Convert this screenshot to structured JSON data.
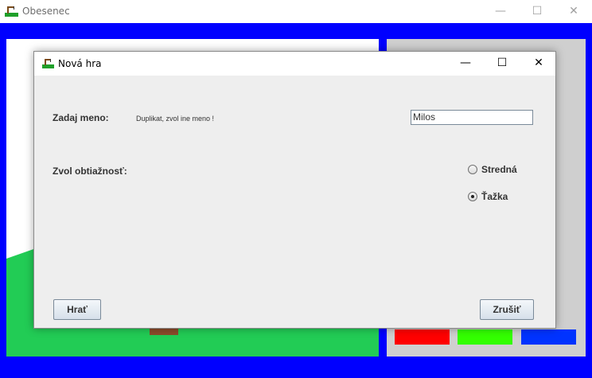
{
  "main_window": {
    "title": "Obesenec",
    "controls": {
      "minimize": "—",
      "maximize": "☐",
      "close": "✕"
    },
    "icon": "gallows-icon"
  },
  "color_swatches": [
    {
      "name": "red",
      "color": "#ff0000"
    },
    {
      "name": "green",
      "color": "#33ff00"
    },
    {
      "name": "blue",
      "color": "#0033ff"
    }
  ],
  "dialog": {
    "title": "Nová hra",
    "icon": "gallows-icon",
    "controls": {
      "minimize": "—",
      "maximize": "☐",
      "close": "✕"
    },
    "name_label": "Zadaj meno:",
    "name_error": "Duplikat, zvol ine meno !",
    "name_value": "Milos",
    "difficulty_label": "Zvol obtiažnosť:",
    "difficulty_options": [
      {
        "label": "Stredná",
        "selected": false
      },
      {
        "label": "Ťažka",
        "selected": true
      }
    ],
    "play_button": "Hrať",
    "cancel_button": "Zrušiť"
  },
  "colors": {
    "background_blue": "#0000ff",
    "ground_green": "#22cc55",
    "panel_gray": "#cfcfcf",
    "dialog_bg": "#eeeeee"
  }
}
